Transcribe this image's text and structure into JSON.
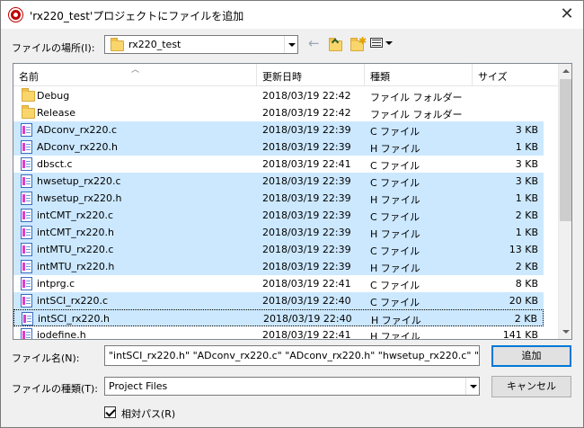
{
  "window": {
    "title": "'rx220_test'プロジェクトにファイルを追加",
    "close_glyph": "✕"
  },
  "location": {
    "label": "ファイルの場所(I):",
    "value": "rx220_test"
  },
  "toolbar": {
    "back_glyph": "←",
    "up_icon": "up-folder-icon",
    "new_folder_icon": "new-folder-icon",
    "view_icon": "view-menu-icon"
  },
  "columns": {
    "name": "名前",
    "date": "更新日時",
    "type": "種類",
    "size": "サイズ"
  },
  "files": [
    {
      "name": "Debug",
      "date": "2018/03/19 22:42",
      "type": "ファイル フォルダー",
      "size": "",
      "kind": "folder",
      "selected": false,
      "focused": false
    },
    {
      "name": "Release",
      "date": "2018/03/19 22:42",
      "type": "ファイル フォルダー",
      "size": "",
      "kind": "folder",
      "selected": false,
      "focused": false
    },
    {
      "name": "ADconv_rx220.c",
      "date": "2018/03/19 22:39",
      "type": "C ファイル",
      "size": "3 KB",
      "kind": "file",
      "selected": true,
      "focused": false
    },
    {
      "name": "ADconv_rx220.h",
      "date": "2018/03/19 22:39",
      "type": "H ファイル",
      "size": "1 KB",
      "kind": "file",
      "selected": true,
      "focused": false
    },
    {
      "name": "dbsct.c",
      "date": "2018/03/19 22:41",
      "type": "C ファイル",
      "size": "3 KB",
      "kind": "file",
      "selected": false,
      "focused": false
    },
    {
      "name": "hwsetup_rx220.c",
      "date": "2018/03/19 22:39",
      "type": "C ファイル",
      "size": "3 KB",
      "kind": "file",
      "selected": true,
      "focused": false
    },
    {
      "name": "hwsetup_rx220.h",
      "date": "2018/03/19 22:39",
      "type": "H ファイル",
      "size": "1 KB",
      "kind": "file",
      "selected": true,
      "focused": false
    },
    {
      "name": "intCMT_rx220.c",
      "date": "2018/03/19 22:39",
      "type": "C ファイル",
      "size": "2 KB",
      "kind": "file",
      "selected": true,
      "focused": false
    },
    {
      "name": "intCMT_rx220.h",
      "date": "2018/03/19 22:39",
      "type": "H ファイル",
      "size": "1 KB",
      "kind": "file",
      "selected": true,
      "focused": false
    },
    {
      "name": "intMTU_rx220.c",
      "date": "2018/03/19 22:39",
      "type": "C ファイル",
      "size": "13 KB",
      "kind": "file",
      "selected": true,
      "focused": false
    },
    {
      "name": "intMTU_rx220.h",
      "date": "2018/03/19 22:39",
      "type": "H ファイル",
      "size": "2 KB",
      "kind": "file",
      "selected": true,
      "focused": false
    },
    {
      "name": "intprg.c",
      "date": "2018/03/19 22:41",
      "type": "C ファイル",
      "size": "8 KB",
      "kind": "file",
      "selected": false,
      "focused": false
    },
    {
      "name": "intSCI_rx220.c",
      "date": "2018/03/19 22:40",
      "type": "C ファイル",
      "size": "20 KB",
      "kind": "file",
      "selected": true,
      "focused": false
    },
    {
      "name": "intSCI_rx220.h",
      "date": "2018/03/19 22:40",
      "type": "H ファイル",
      "size": "2 KB",
      "kind": "file",
      "selected": true,
      "focused": true
    },
    {
      "name": "iodefine.h",
      "date": "2018/03/19 22:41",
      "type": "H ファイル",
      "size": "141 KB",
      "kind": "file",
      "selected": false,
      "focused": false
    }
  ],
  "filename": {
    "label": "ファイル名(N):",
    "value": "\"intSCI_rx220.h\" \"ADconv_rx220.c\" \"ADconv_rx220.h\" \"hwsetup_rx220.c\" \"hwse"
  },
  "filetype": {
    "label": "ファイルの種類(T):",
    "value": "Project Files"
  },
  "buttons": {
    "add": "追加",
    "cancel": "キャンセル"
  },
  "relative_path": {
    "label": "相対パス(R)",
    "checked": true
  }
}
